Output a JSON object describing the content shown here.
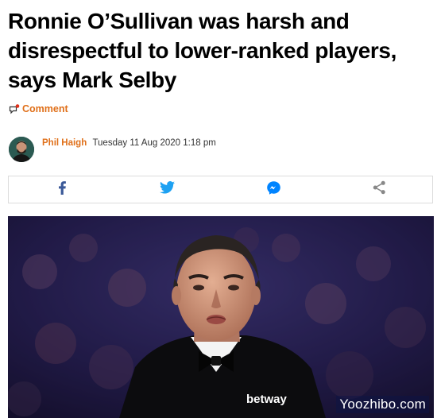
{
  "article": {
    "headline": "Ronnie O’Sullivan was harsh and disrespectful to lower-ranked players, says Mark Selby",
    "comment_label": "Comment",
    "author": "Phil Haigh",
    "date": "Tuesday 11 Aug 2020 1:18 pm"
  },
  "share_bar": {
    "buttons": [
      {
        "icon": "facebook-icon",
        "color": "#3b5998"
      },
      {
        "icon": "twitter-icon",
        "color": "#1da1f2"
      },
      {
        "icon": "messenger-icon",
        "color": "#0084ff"
      },
      {
        "icon": "share-icon",
        "color": "#888888"
      }
    ]
  },
  "hero_image": {
    "shirt_brand": "betway",
    "watermark": "Yoozhibo.com"
  },
  "colors": {
    "accent": "#e0701a",
    "border": "#dcdcdc"
  }
}
